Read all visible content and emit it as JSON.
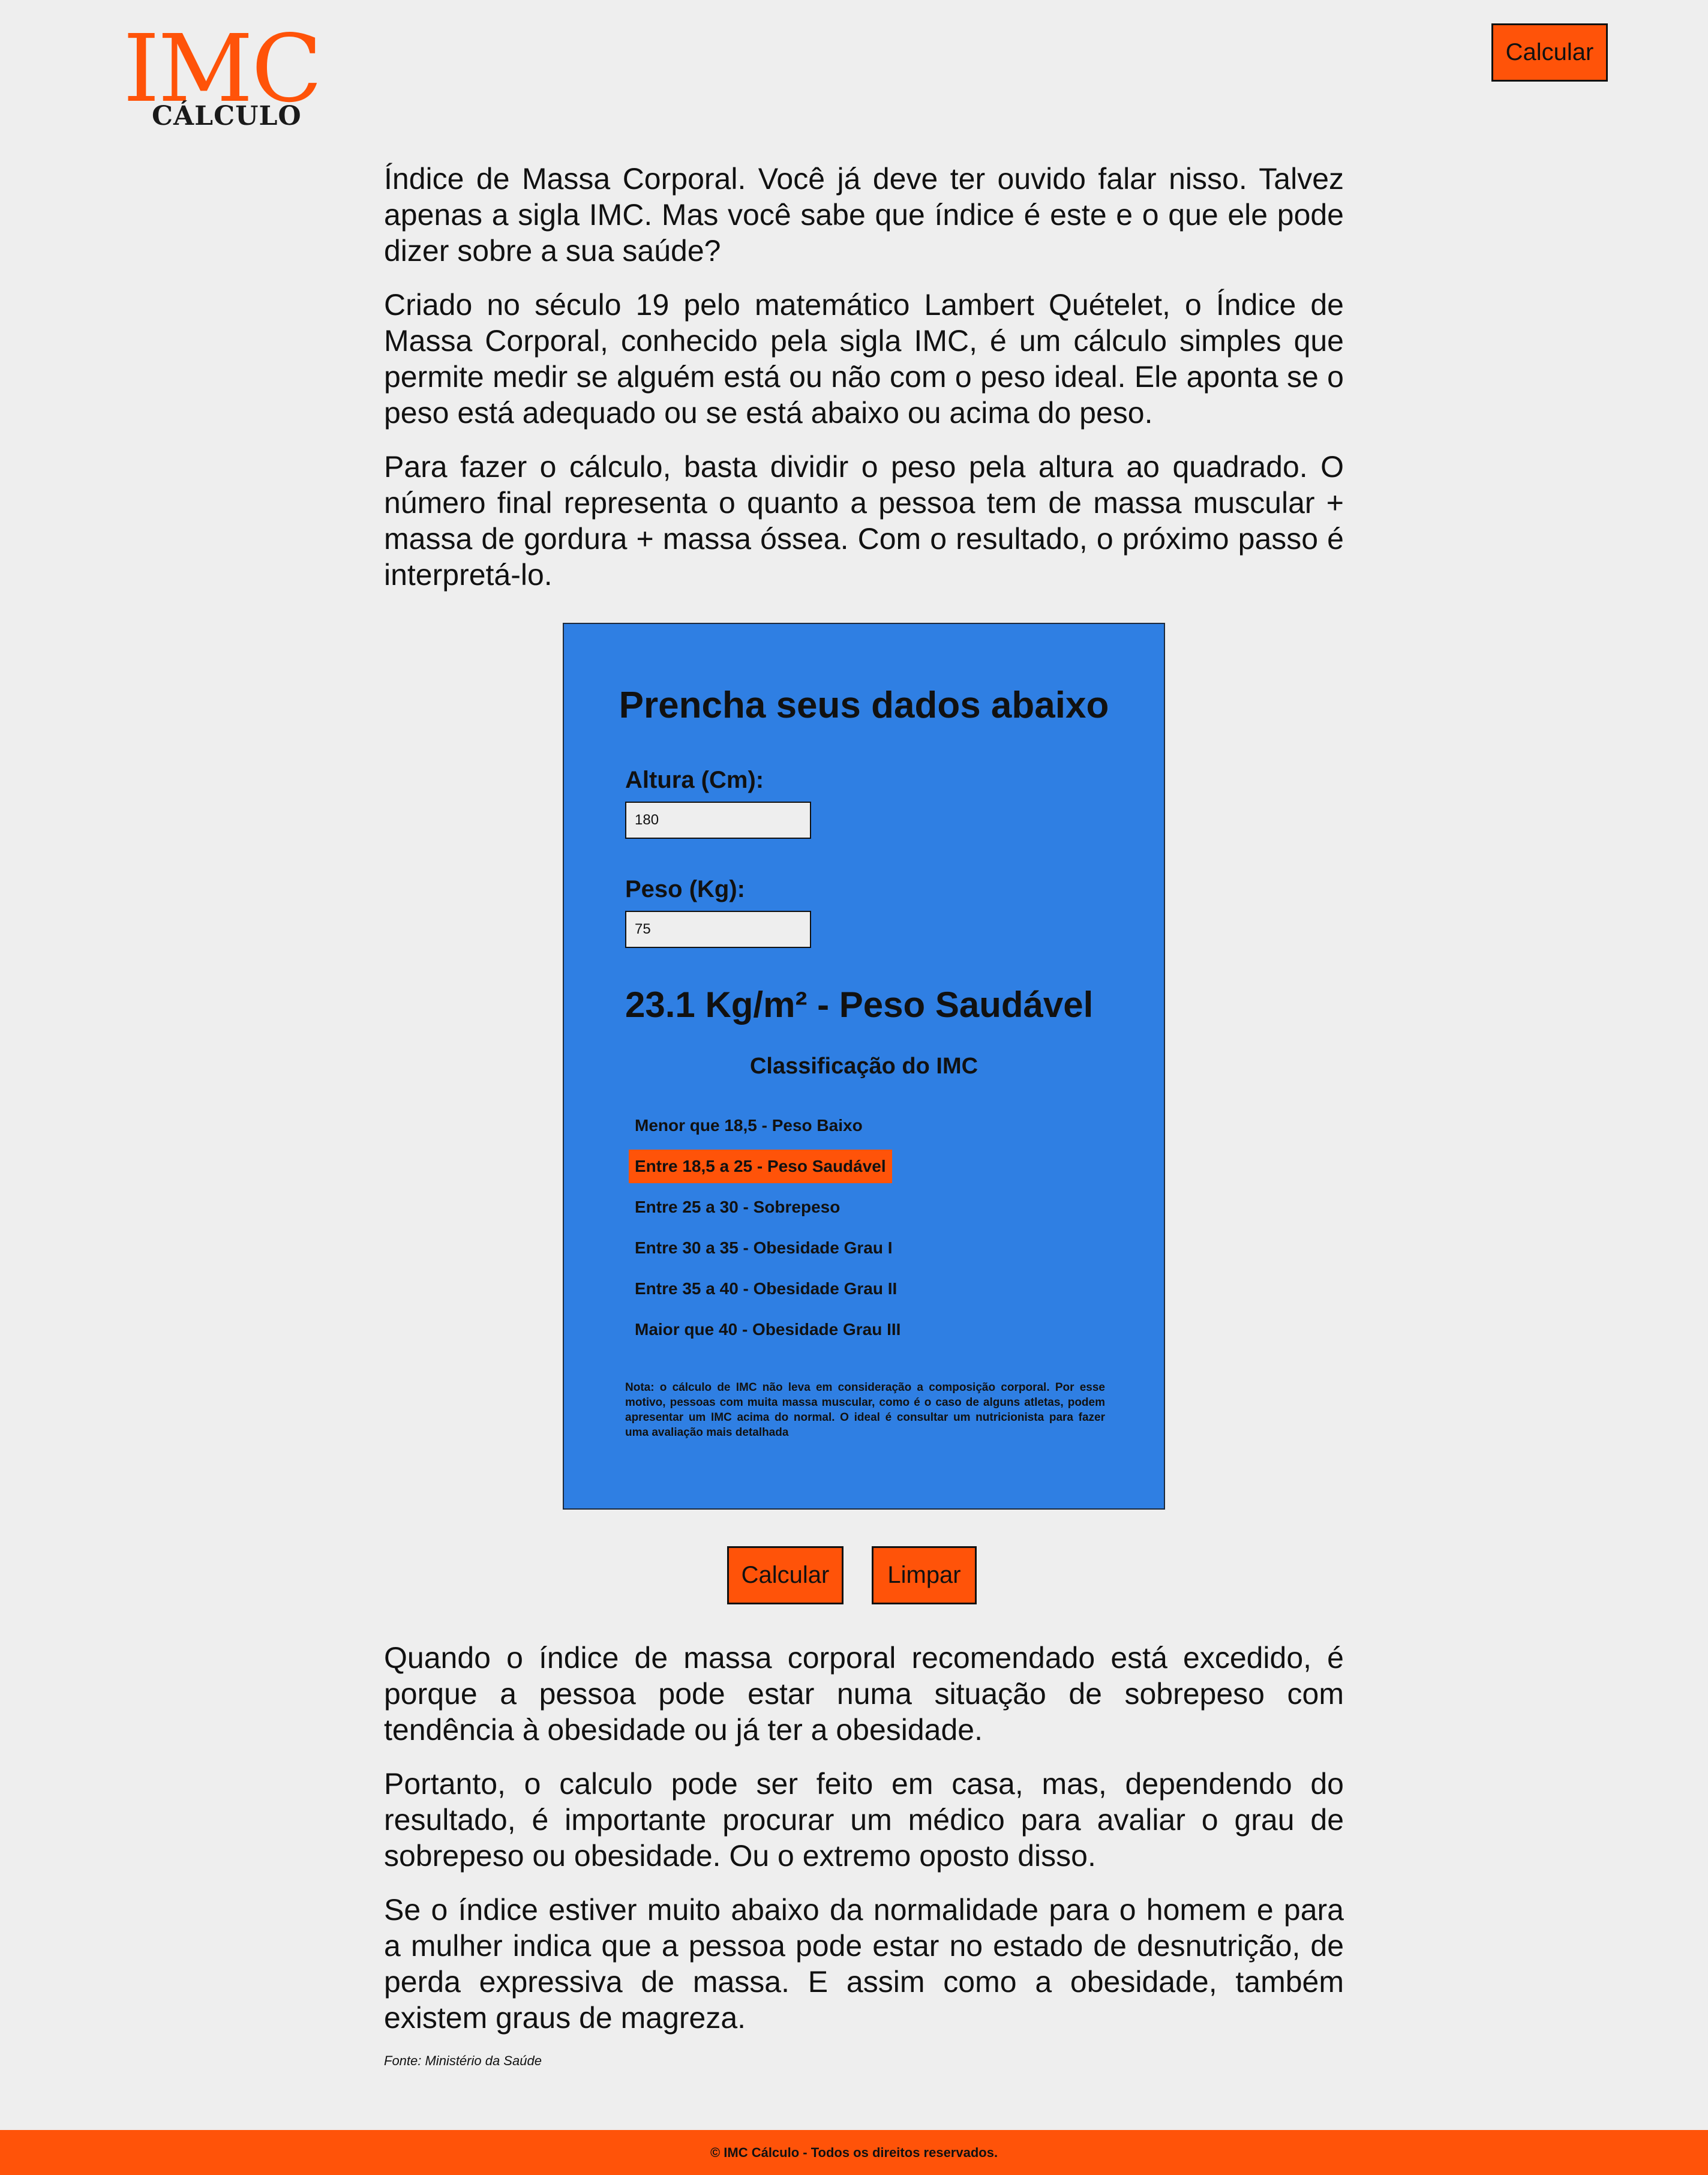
{
  "logo": {
    "big": "IMC",
    "small": "CÁLCULO"
  },
  "header": {
    "calc_button": "Calcular"
  },
  "intro": [
    "Índice de Massa Corporal. Você já deve ter ouvido falar nisso. Talvez apenas a sigla IMC. Mas você sabe que índice é este e o que ele pode dizer sobre a sua saúde?",
    "Criado no século 19 pelo matemático Lambert Quételet, o Índice de Massa Corporal, conhecido pela sigla IMC, é um cálculo simples que permite medir se alguém está ou não com o peso ideal. Ele aponta se o peso está adequado ou se está abaixo ou acima do peso.",
    "Para fazer o cálculo, basta dividir o peso pela altura ao quadrado. O número final representa o quanto a pessoa tem de massa muscular + massa de gordura + massa óssea. Com o resultado, o próximo passo é interpretá-lo."
  ],
  "form": {
    "title": "Prencha seus dados abaixo",
    "height_label": "Altura (Cm):",
    "height_value": "180",
    "weight_label": "Peso (Kg):",
    "weight_value": "75",
    "result": "23.1 Kg/m² - Peso Saudável",
    "classification_title": "Classificação do IMC",
    "classifications": [
      "Menor que 18,5 - Peso Baixo",
      "Entre 18,5 a 25 - Peso Saudável",
      "Entre 25 a 30 - Sobrepeso",
      "Entre 30 a 35 - Obesidade Grau I",
      "Entre 35 a 40 - Obesidade Grau II",
      "Maior que 40 - Obesidade Grau III"
    ],
    "note": "Nota: o cálculo de IMC não leva em consideração a composição corporal. Por esse motivo, pessoas com muita massa muscular, como é o caso de alguns atletas, podem apresentar um IMC acima do normal. O ideal é consultar um nutricionista para fazer uma avaliação mais detalhada"
  },
  "actions": {
    "calc": "Calcular",
    "clear": "Limpar"
  },
  "outro": [
    "Quando o índice de massa corporal recomendado está excedido, é porque a pessoa pode estar numa situação de sobrepeso com tendência à obesidade ou já ter a obesidade.",
    "Portanto, o calculo pode ser feito em casa, mas, dependendo do resultado, é importante procurar um médico para avaliar o grau de sobrepeso ou obesidade. Ou o extremo oposto disso.",
    "Se o índice estiver muito abaixo da normalidade para o homem e para a mulher indica que a pessoa pode estar no estado de desnutrição, de perda expressiva de massa. E assim como a obesidade, também existem graus de magreza."
  ],
  "source": "Fonte: Ministério da Saúde",
  "footer": "© IMC Cálculo - Todos os direitos reservados.",
  "colors": {
    "accent": "#ff5309",
    "panel": "#2f7fe3",
    "background": "#eeeeee"
  }
}
